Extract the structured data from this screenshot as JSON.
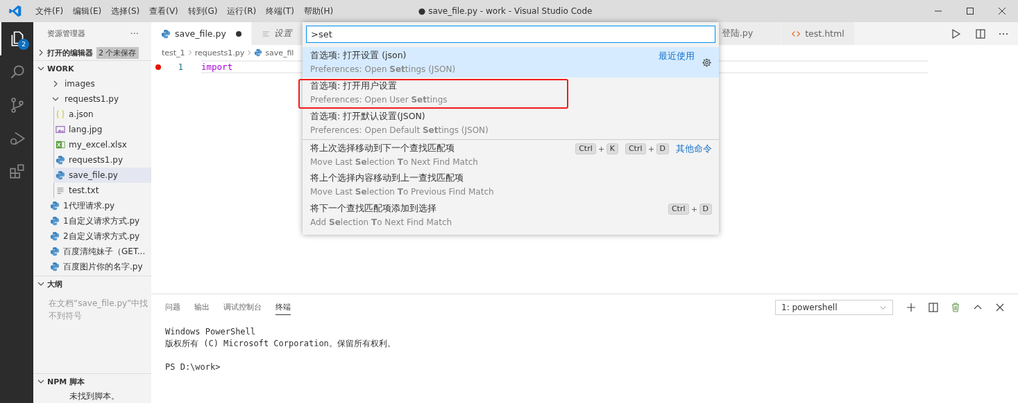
{
  "title_bar": {
    "menus": [
      "文件(F)",
      "编辑(E)",
      "选择(S)",
      "查看(V)",
      "转到(G)",
      "运行(R)",
      "终端(T)",
      "帮助(H)"
    ],
    "title": "● save_file.py - work - Visual Studio Code"
  },
  "activity_bar": [
    {
      "kind": "files",
      "selected": true,
      "badge": "2"
    },
    {
      "kind": "search",
      "selected": false
    },
    {
      "kind": "source-control",
      "selected": false
    },
    {
      "kind": "debug",
      "selected": false
    },
    {
      "kind": "extensions",
      "selected": false
    }
  ],
  "sidebar": {
    "title": "资源管理器",
    "more": "···",
    "open_editors": {
      "label": "打开的编辑器",
      "badge": "2 个未保存",
      "expanded": false
    },
    "workspace": {
      "label": "WORK",
      "expanded": true,
      "items": [
        {
          "name": "images",
          "kind": "folder",
          "expanded": false,
          "selected": false
        },
        {
          "name": "requests1.py",
          "kind": "folder",
          "expanded": true,
          "selected": false,
          "children": [
            {
              "name": "a.json",
              "kind": "json",
              "selected": false
            },
            {
              "name": "lang.jpg",
              "kind": "image",
              "selected": false
            },
            {
              "name": "my_excel.xlsx",
              "kind": "excel",
              "selected": false
            },
            {
              "name": "requests1.py",
              "kind": "python",
              "selected": false
            },
            {
              "name": "save_file.py",
              "kind": "python",
              "selected": true
            },
            {
              "name": "test.txt",
              "kind": "text",
              "selected": false
            }
          ]
        },
        {
          "name": "1代理请求.py",
          "kind": "python",
          "selected": false
        },
        {
          "name": "1自定义请求方式.py",
          "kind": "python",
          "selected": false
        },
        {
          "name": "2自定义请求方式.py",
          "kind": "python",
          "selected": false
        },
        {
          "name": "百度清纯妹子（GET...",
          "kind": "python",
          "selected": false
        },
        {
          "name": "百度图片你的名字.py",
          "kind": "python",
          "selected": false
        }
      ]
    },
    "outline": {
      "label": "大纲",
      "expanded": true,
      "message": "在文档“save_file.py”中找不到符号"
    },
    "npm": {
      "label": "NPM 脚本",
      "expanded": true,
      "message": "未找到脚本。"
    }
  },
  "tabs": [
    {
      "label": "save_file.py",
      "kind": "python",
      "selected": true,
      "dirty": true,
      "preview": false
    },
    {
      "label": "设置",
      "kind": "settings",
      "selected": false,
      "dirty": false,
      "preview": true
    },
    {
      "label": "登陆.py",
      "kind": "none",
      "selected": false,
      "dirty": false,
      "preview": false
    },
    {
      "label": "test.html",
      "kind": "html",
      "selected": false,
      "dirty": false,
      "preview": false
    }
  ],
  "breadcrumb": [
    "test_1",
    "requests1.py",
    "save_fil"
  ],
  "editor": {
    "lines": [
      {
        "number": "1",
        "breakpoint": true,
        "code": "import"
      }
    ]
  },
  "command_palette": {
    "value": ">set",
    "items": [
      {
        "label": "首选项: 打开设置 (json)",
        "detail": "Preferences: Open **Set**tings (JSON)",
        "selected": true,
        "separator": false,
        "tag": "最近使用"
      },
      {
        "label": "首选项: 打开用户设置",
        "detail": "Preferences: Open User **Set**tings",
        "selected": false,
        "separator": false
      },
      {
        "label": "首选项: 打开默认设置(JSON)",
        "detail": "Preferences: Open Default **Set**tings (JSON)",
        "selected": false,
        "separator": false
      },
      {
        "label": "将上次选择移动到下一个查找匹配项",
        "detail": "Move Last **Se**lection **T**o Next Find Match",
        "selected": false,
        "separator": true,
        "tag": "其他命令",
        "keys": [
          [
            "Ctrl",
            "K"
          ],
          [
            "Ctrl",
            "D"
          ]
        ]
      },
      {
        "label": "将上个选择内容移动到上一查找匹配项",
        "detail": "Move Last **Se**lection **T**o Previous Find Match",
        "selected": false,
        "separator": false
      },
      {
        "label": "将下一个查找匹配项添加到选择",
        "detail": "Add **Se**lection **T**o Next Find Match",
        "selected": false,
        "separator": false,
        "keys": [
          [
            "Ctrl",
            "D"
          ]
        ]
      }
    ]
  },
  "panel": {
    "tabs": [
      {
        "label": "问题",
        "selected": false
      },
      {
        "label": "输出",
        "selected": false
      },
      {
        "label": "调试控制台",
        "selected": false
      },
      {
        "label": "终端",
        "selected": true
      }
    ],
    "terminal_select": "1: powershell",
    "terminal_lines": [
      "Windows PowerShell",
      "版权所有 (C) Microsoft Corporation。保留所有权利。"
    ],
    "prompt": "PS D:\\work>"
  }
}
